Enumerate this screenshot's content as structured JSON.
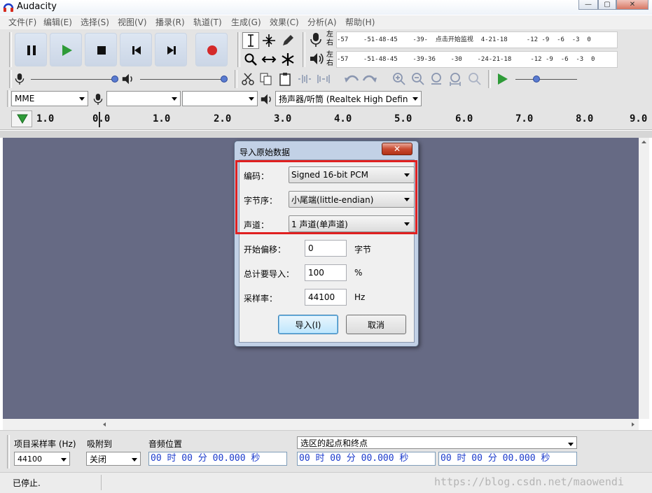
{
  "window": {
    "title": "Audacity"
  },
  "menu": [
    "文件(F)",
    "编辑(E)",
    "选择(S)",
    "视图(V)",
    "播录(R)",
    "轨道(T)",
    "生成(G)",
    "效果(C)",
    "分析(A)",
    "帮助(H)"
  ],
  "meter": {
    "rec_lr": [
      "左",
      "右"
    ],
    "play_lr": [
      "左",
      "右"
    ],
    "rec_scale": "-57    -51-48-45    -39-  点击开始监视  4-21-18     -12 -9  -6  -3  0",
    "play_scale": "-57    -51-48-45    -39-36    -30    -24-21-18     -12 -9  -6  -3  0"
  },
  "device": {
    "host": "MME",
    "rec_device": "",
    "rec_channels": "",
    "play_device": "扬声器/听筒 (Realtek High Defin"
  },
  "ruler": {
    "ticks": [
      "1.0",
      "0.0",
      "1.0",
      "2.0",
      "3.0",
      "4.0",
      "5.0",
      "6.0",
      "7.0",
      "8.0",
      "9.0"
    ]
  },
  "dialog": {
    "title": "导入原始数据",
    "close": "✕",
    "encoding_label": "编码：",
    "encoding_value": "Signed 16-bit PCM",
    "byte_order_label": "字节序：",
    "byte_order_value": "小尾端(little-endian)",
    "channels_label": "声道：",
    "channels_value": "1 声道(单声道)",
    "offset_label": "开始偏移：",
    "offset_value": "0",
    "offset_unit": "字节",
    "amount_label": "总计要导入：",
    "amount_value": "100",
    "amount_unit": "%",
    "rate_label": "采样率：",
    "rate_value": "44100",
    "rate_unit": "Hz",
    "import_button": "导入(I)",
    "cancel_button": "取消"
  },
  "selection": {
    "project_rate_label": "项目采样率 (Hz)",
    "project_rate_value": "44100",
    "snap_label": "吸附到",
    "snap_value": "关闭",
    "audio_pos_label": "音频位置",
    "audio_pos_value": "00 时 00 分 00.000 秒",
    "sel_mode_value": "选区的起点和终点",
    "sel_start_value": "00 时 00 分 00.000 秒",
    "sel_end_value": "00 时 00 分 00.000 秒"
  },
  "status": {
    "text": "已停止."
  },
  "watermark": "https://blog.csdn.net/maowendi",
  "colors": {
    "track_bg": "#666a84",
    "play_green": "#2e9b38",
    "record_red": "#d42a2a",
    "highlight_red": "#e02020"
  }
}
